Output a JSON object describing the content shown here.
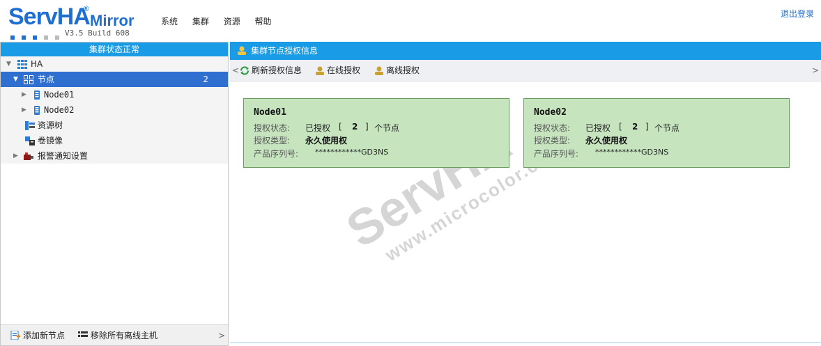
{
  "logo": {
    "brand": "ServHA",
    "reg": "®",
    "product": "Mirror",
    "version": "V3.5 Build 608"
  },
  "menu": [
    "系统",
    "集群",
    "资源",
    "帮助"
  ],
  "logout": "退出登录",
  "left_panel": {
    "status": "集群状态正常",
    "tree": {
      "root": "HA",
      "nodes_label": "节点",
      "nodes_count": "2",
      "node1": "Node01",
      "node2": "Node02",
      "resource_tree": "资源树",
      "volume_mirror": "卷镜像",
      "alarm_settings": "报警通知设置"
    },
    "footer": {
      "add_node": "添加新节点",
      "remove_offline": "移除所有离线主机",
      "more": ">"
    }
  },
  "right_panel": {
    "title": "集群节点授权信息",
    "toolbar": {
      "refresh": "刷新授权信息",
      "online": "在线授权",
      "offline": "离线授权",
      "left_arrow": "<",
      "right_arrow": ">"
    },
    "labels": {
      "status": "授权状态:",
      "type": "授权类型:",
      "serial": "产品序列号:",
      "bracket_open": "[",
      "bracket_close": "]",
      "unit": "个节点"
    },
    "cards": [
      {
        "name": "Node01",
        "status": "已授权",
        "count": "2",
        "type": "永久使用权",
        "serial": "************GD3NS"
      },
      {
        "name": "Node02",
        "status": "已授权",
        "count": "2",
        "type": "永久使用权",
        "serial": "************GD3NS"
      }
    ],
    "watermark": {
      "brand": "ServHA",
      "reg": "®",
      "url": "www.microcolor.cn"
    }
  },
  "colors": {
    "accent": "#1a9be6",
    "selected": "#2e6fcf",
    "card_bg": "#c6e5bf",
    "card_border": "#6a9a5e"
  }
}
